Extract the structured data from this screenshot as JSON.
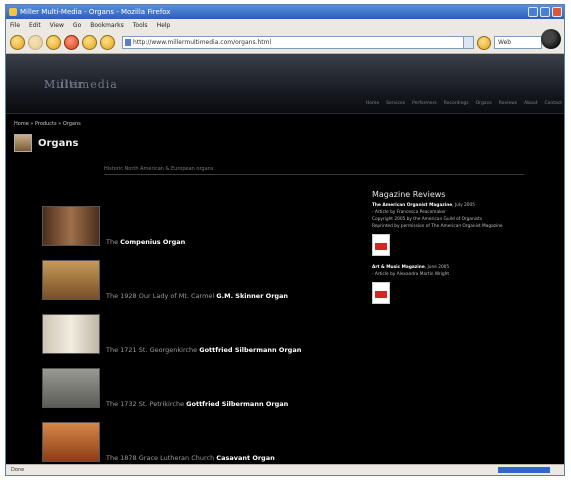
{
  "window": {
    "title": "Miller Multi-Media - Organs - Mozilla Firefox"
  },
  "menu": [
    "File",
    "Edit",
    "View",
    "Go",
    "Bookmarks",
    "Tools",
    "Help"
  ],
  "toolbar": {
    "url": "http://www.millermultimedia.com/organs.html",
    "search_placeholder": "Web"
  },
  "site": {
    "logo": "Miller",
    "logo_sub": "Multimedia",
    "nav": [
      "Home",
      "Services",
      "Performers",
      "Recordings",
      "Organs",
      "Reviews",
      "About",
      "Contact"
    ]
  },
  "breadcrumb": "Home » Products » Organs",
  "page_title": "Organs",
  "subtitle": "Historic North American & European organs",
  "organs": [
    {
      "prefix": "The ",
      "name": "Compenius Organ"
    },
    {
      "prefix": "The 1928 Our Lady of Mt. Carmel ",
      "name": "G.M. Skinner Organ"
    },
    {
      "prefix": "The 1721 St. Georgenkirche ",
      "name": "Gottfried Silbermann Organ"
    },
    {
      "prefix": "The 1732 St. Petrikirche ",
      "name": "Gottfried Silbermann Organ"
    },
    {
      "prefix": "The 1878 Grace Lutheran Church ",
      "name": "Casavant Organ"
    }
  ],
  "reviews": {
    "title": "Magazine Reviews",
    "review1": {
      "source": "The American Organist Magazine",
      "date": ", July 2005",
      "lines": [
        "- Article by Francesca Peacemaker",
        "Copyright 2005 by the American Guild of Organists",
        "Reprinted by permission of The American Organist Magazine"
      ]
    },
    "review2": {
      "source": "Art & Music Magazine",
      "date": ", June 2005",
      "lines": [
        "- Article by Alexandra Martin Wright"
      ]
    }
  },
  "status": "Done"
}
